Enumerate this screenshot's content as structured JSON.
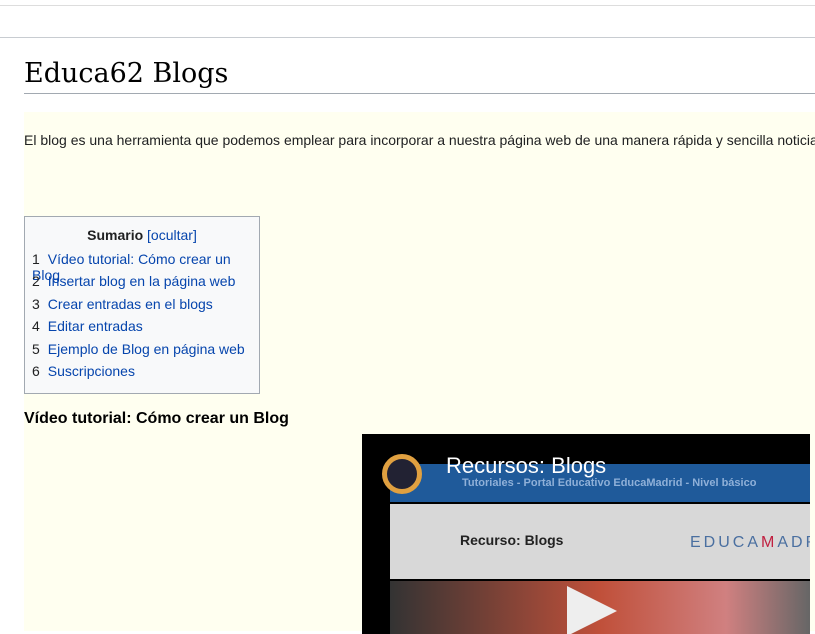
{
  "page": {
    "title": "Educa62 Blogs",
    "intro": "El blog es una herramienta que podemos emplear para incorporar a nuestra página web de una manera rápida y sencilla noticia"
  },
  "toc": {
    "title": "Sumario",
    "toggle": "[ocultar]",
    "items": [
      {
        "num": "1",
        "label": "Vídeo tutorial: Cómo crear un Blog"
      },
      {
        "num": "2",
        "label": "Insertar blog en la página web"
      },
      {
        "num": "3",
        "label": "Crear entradas en el blogs"
      },
      {
        "num": "4",
        "label": "Editar entradas"
      },
      {
        "num": "5",
        "label": "Ejemplo de Blog en página web"
      },
      {
        "num": "6",
        "label": "Suscripciones"
      }
    ]
  },
  "section": {
    "heading": "Vídeo tutorial: Cómo crear un Blog"
  },
  "video": {
    "title": "Recursos: Blogs",
    "subtitle": "Tutoriales - Portal Educativo EducaMadrid - Nivel básico",
    "panel_text": "Recurso: Blogs",
    "brand_a": "EDUCA",
    "brand_b": "M",
    "brand_c": "ADRID"
  }
}
